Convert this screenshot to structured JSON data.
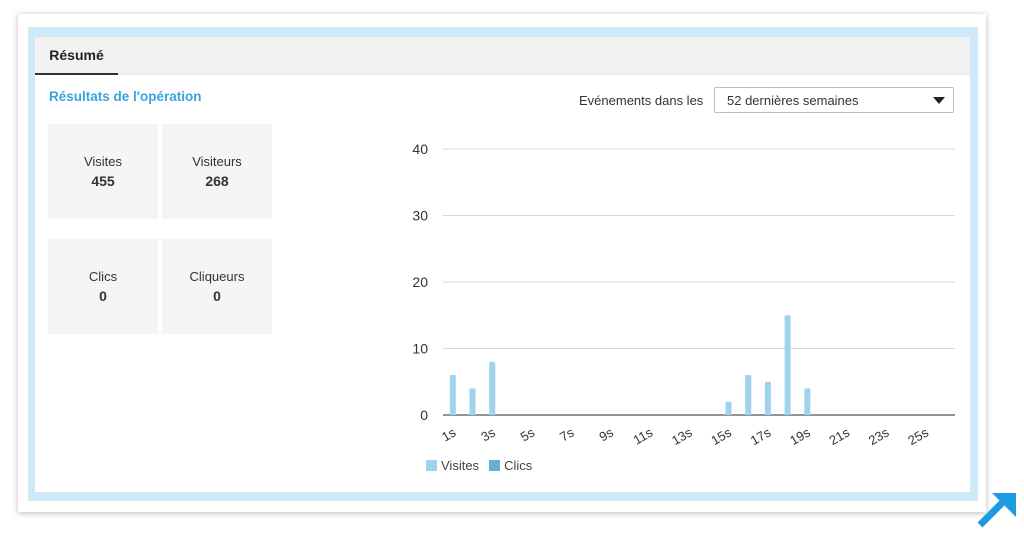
{
  "tabs": [
    {
      "label": "Résumé",
      "active": true
    }
  ],
  "section_title": "Résultats de l'opération",
  "stats": [
    {
      "label": "Visites",
      "value": "455"
    },
    {
      "label": "Visiteurs",
      "value": "268"
    },
    {
      "label": "Clics",
      "value": "0"
    },
    {
      "label": "Cliqueurs",
      "value": "0"
    }
  ],
  "filter": {
    "label": "Evénements dans les",
    "selected": "52 dernières semaines"
  },
  "colors": {
    "visites": "#9fd2ee",
    "clics": "#6aaed6",
    "accent": "#3ba3e0",
    "frame": "#cfe9f8",
    "corner_arrow": "#1e9be0"
  },
  "corner_icon": "diagonal-arrow-icon",
  "chart_data": {
    "type": "bar",
    "categories": [
      "1s",
      "2s",
      "3s",
      "4s",
      "5s",
      "6s",
      "7s",
      "8s",
      "9s",
      "10s",
      "11s",
      "12s",
      "13s",
      "14s",
      "15s",
      "16s",
      "17s",
      "18s",
      "19s",
      "20s",
      "21s",
      "22s",
      "23s",
      "24s",
      "25s",
      "26s"
    ],
    "tick_labels": [
      "1s",
      "3s",
      "5s",
      "7s",
      "9s",
      "11s",
      "13s",
      "15s",
      "17s",
      "19s",
      "21s",
      "23s",
      "25s"
    ],
    "series": [
      {
        "name": "Visites",
        "values": [
          6,
          4,
          8,
          0,
          0,
          0,
          0,
          0,
          0,
          0,
          0,
          0,
          0,
          0,
          2,
          6,
          5,
          15,
          4,
          0,
          0,
          0,
          0,
          0,
          0,
          0
        ]
      },
      {
        "name": "Clics",
        "values": [
          0,
          0,
          0,
          0,
          0,
          0,
          0,
          0,
          0,
          0,
          0,
          0,
          0,
          0,
          0,
          0,
          0,
          0,
          0,
          0,
          0,
          0,
          0,
          0,
          0,
          0
        ]
      }
    ],
    "ylim": [
      0,
      40
    ],
    "yticks": [
      0,
      10,
      20,
      30,
      40
    ],
    "grid": true,
    "legend": "bottom-left"
  }
}
